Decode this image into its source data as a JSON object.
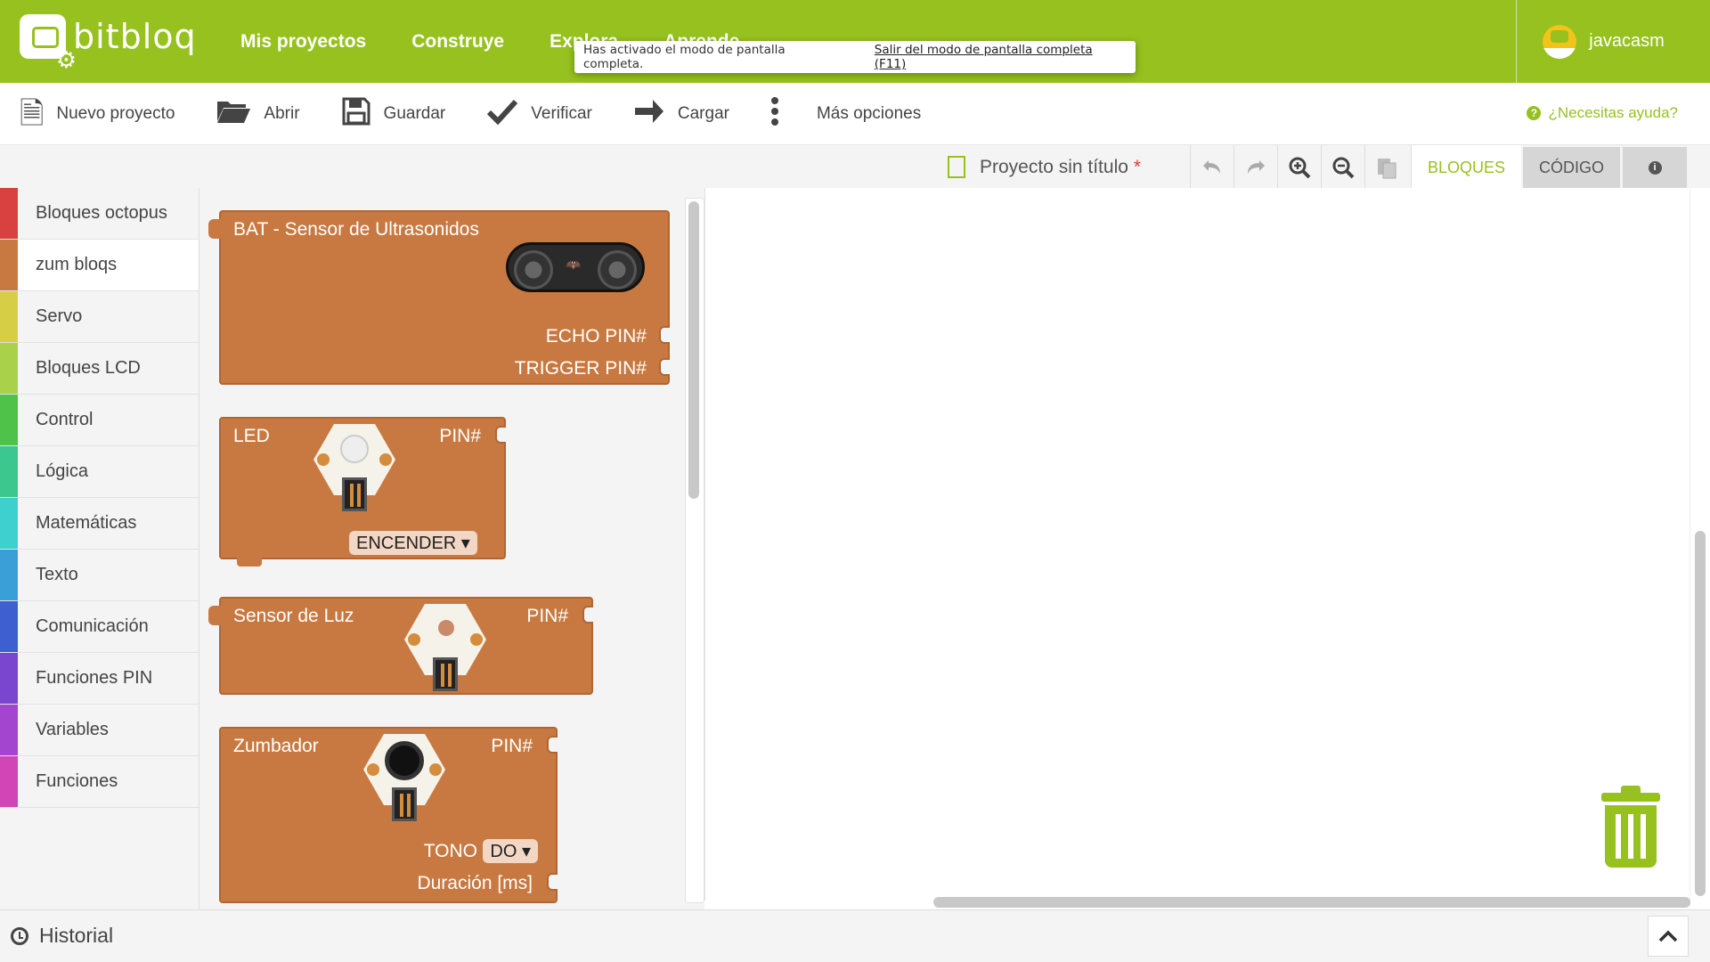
{
  "app": {
    "logo_text": "bitbloq",
    "nav": [
      "Mis proyectos",
      "Construye",
      "Explora",
      "Aprende"
    ],
    "username": "javacasm"
  },
  "fullscreen_notice": {
    "message": "Has activado el modo de pantalla completa.",
    "exit_label": "Salir del modo de pantalla completa (F11)"
  },
  "toolbar": {
    "new_project": "Nuevo proyecto",
    "open": "Abrir",
    "save": "Guardar",
    "verify": "Verificar",
    "upload": "Cargar",
    "more": "Más opciones",
    "help": "¿Necesitas ayuda?"
  },
  "editor": {
    "project_title": "Proyecto sin título",
    "unsaved_marker": "*",
    "tabs": {
      "blocks": "BLOQUES",
      "code": "CÓDIGO",
      "info_icon": "info-icon"
    },
    "buttons": [
      "undo-icon",
      "redo-icon",
      "zoom-in-icon",
      "zoom-out-icon",
      "paste-icon"
    ]
  },
  "categories": [
    {
      "label": "Bloques octopus",
      "color": "#d94040"
    },
    {
      "label": "zum bloqs",
      "color": "#c87941",
      "active": true
    },
    {
      "label": "Servo",
      "color": "#d6cf46"
    },
    {
      "label": "Bloques LCD",
      "color": "#a9d14a"
    },
    {
      "label": "Control",
      "color": "#4fc24a"
    },
    {
      "label": "Lógica",
      "color": "#3cc78e"
    },
    {
      "label": "Matemáticas",
      "color": "#3ecfcf"
    },
    {
      "label": "Texto",
      "color": "#3a9fd6"
    },
    {
      "label": "Comunicación",
      "color": "#3d5fd0"
    },
    {
      "label": "Funciones PIN",
      "color": "#7a45cf"
    },
    {
      "label": "Variables",
      "color": "#a445cf"
    },
    {
      "label": "Funciones",
      "color": "#d145b6"
    }
  ],
  "blocks": {
    "bat": {
      "title": "BAT - Sensor de Ultrasonidos",
      "echo": "ECHO PIN#",
      "trigger": "TRIGGER PIN#"
    },
    "led": {
      "title": "LED",
      "pin": "PIN#",
      "state": "ENCENDER ▾"
    },
    "light": {
      "title": "Sensor de Luz",
      "pin": "PIN#"
    },
    "buzzer": {
      "title": "Zumbador",
      "pin": "PIN#",
      "tone_label": "TONO",
      "tone_value": "DO ▾",
      "duration": "Duración [ms]"
    }
  },
  "bottom": {
    "history": "Historial"
  },
  "colors": {
    "brand": "#96c11f",
    "block": "#c87941"
  }
}
